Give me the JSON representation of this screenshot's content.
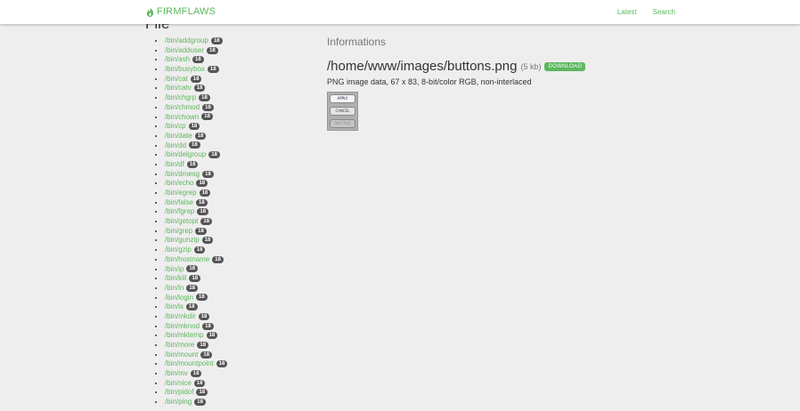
{
  "brand": {
    "name": "FIRMFLAWS",
    "icon": "flame-icon",
    "color": "#5cb85c"
  },
  "nav": {
    "latest": "Latest",
    "search": "Search"
  },
  "sidebar": {
    "heading": "File",
    "files": [
      {
        "name": "/bin/addgroup",
        "count": "18"
      },
      {
        "name": "/bin/adduser",
        "count": "18"
      },
      {
        "name": "/bin/ash",
        "count": "18"
      },
      {
        "name": "/bin/busybox",
        "count": "18"
      },
      {
        "name": "/bin/cat",
        "count": "18"
      },
      {
        "name": "/bin/catv",
        "count": "18"
      },
      {
        "name": "/bin/chgrp",
        "count": "18"
      },
      {
        "name": "/bin/chmod",
        "count": "18"
      },
      {
        "name": "/bin/chown",
        "count": "18"
      },
      {
        "name": "/bin/cp",
        "count": "18"
      },
      {
        "name": "/bin/date",
        "count": "18"
      },
      {
        "name": "/bin/dd",
        "count": "18"
      },
      {
        "name": "/bin/delgroup",
        "count": "18"
      },
      {
        "name": "/bin/df",
        "count": "18"
      },
      {
        "name": "/bin/dmesg",
        "count": "18"
      },
      {
        "name": "/bin/echo",
        "count": "18"
      },
      {
        "name": "/bin/egrep",
        "count": "18"
      },
      {
        "name": "/bin/false",
        "count": "18"
      },
      {
        "name": "/bin/fgrep",
        "count": "18"
      },
      {
        "name": "/bin/getopt",
        "count": "18"
      },
      {
        "name": "/bin/grep",
        "count": "18"
      },
      {
        "name": "/bin/gunzip",
        "count": "18"
      },
      {
        "name": "/bin/gzip",
        "count": "18"
      },
      {
        "name": "/bin/hostname",
        "count": "18"
      },
      {
        "name": "/bin/ip",
        "count": "18"
      },
      {
        "name": "/bin/kill",
        "count": "18"
      },
      {
        "name": "/bin/ln",
        "count": "18"
      },
      {
        "name": "/bin/login",
        "count": "18"
      },
      {
        "name": "/bin/ls",
        "count": "18"
      },
      {
        "name": "/bin/mkdir",
        "count": "18"
      },
      {
        "name": "/bin/mknod",
        "count": "18"
      },
      {
        "name": "/bin/mktemp",
        "count": "18"
      },
      {
        "name": "/bin/more",
        "count": "18"
      },
      {
        "name": "/bin/mount",
        "count": "18"
      },
      {
        "name": "/bin/mountpoint",
        "count": "18"
      },
      {
        "name": "/bin/mv",
        "count": "18"
      },
      {
        "name": "/bin/nice",
        "count": "18"
      },
      {
        "name": "/bin/pidof",
        "count": "18"
      },
      {
        "name": "/bin/ping",
        "count": "18"
      }
    ]
  },
  "main": {
    "section_title": "Informations",
    "file_path": "/home/www/images/buttons.png",
    "file_size": "(5 kb)",
    "download_label": "DOWNLOAD",
    "description": "PNG image data, 67 x 83, 8-bit/color RGB, non-interlaced",
    "preview_buttons": [
      "APPLY",
      "CANCEL",
      "INACTIVE"
    ]
  }
}
